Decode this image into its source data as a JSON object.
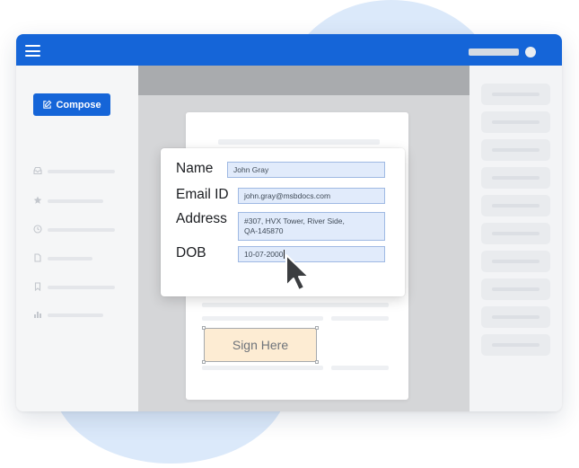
{
  "sidebar": {
    "compose_label": "Compose",
    "items": [
      {
        "icon": "inbox-icon"
      },
      {
        "icon": "star-icon"
      },
      {
        "icon": "clock-icon"
      },
      {
        "icon": "file-icon"
      },
      {
        "icon": "bookmark-icon"
      },
      {
        "icon": "bar-chart-icon"
      }
    ]
  },
  "form": {
    "name_label": "Name",
    "name_value": "John Gray",
    "email_label": "Email ID",
    "email_value": "john.gray@msbdocs.com",
    "address_label": "Address",
    "address_value": "#307, HVX Tower, River Side,\nQA-145870",
    "dob_label": "DOB",
    "dob_value": "10-07-2000"
  },
  "document": {
    "sign_label": "Sign Here"
  },
  "colors": {
    "accent": "#1565d8",
    "input_fill": "#e1ebfb",
    "sign_fill": "#fdecd3"
  }
}
